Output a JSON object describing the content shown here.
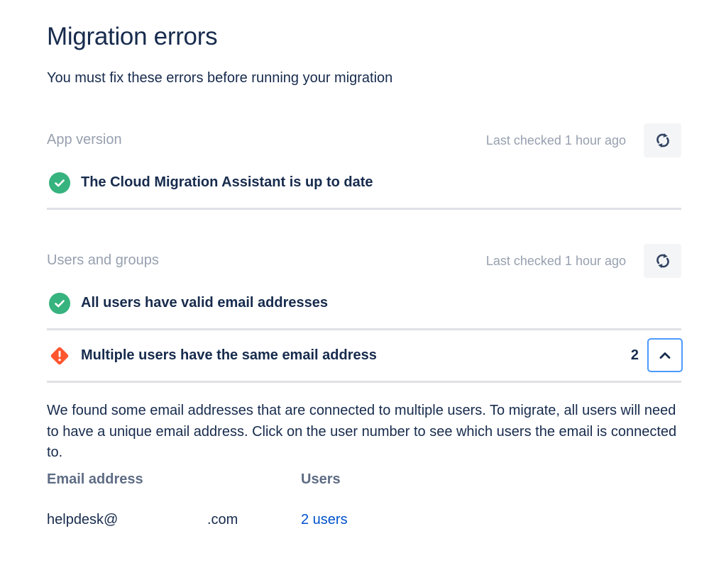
{
  "page": {
    "title": "Migration errors",
    "subtitle": "You must fix these errors before running your migration"
  },
  "sections": [
    {
      "title": "App version",
      "last_checked": "Last checked 1 hour ago",
      "checks": [
        {
          "status": "success",
          "text": "The Cloud Migration Assistant is up to date"
        }
      ]
    },
    {
      "title": "Users and groups",
      "last_checked": "Last checked 1 hour ago",
      "checks": [
        {
          "status": "success",
          "text": "All users have valid email addresses"
        },
        {
          "status": "error",
          "text": "Multiple users have the same email address",
          "count": "2",
          "expanded": true
        }
      ]
    }
  ],
  "error_details": {
    "description": "We found some email addresses that are connected to multiple users. To migrate, all users will need to have a unique email address. Click on the user number to see which users the email is connected to.",
    "table": {
      "headers": [
        "Email address",
        "Users"
      ],
      "rows": [
        {
          "email_prefix": "helpdesk@",
          "email_suffix": ".com",
          "users": "2 users"
        }
      ]
    }
  },
  "colors": {
    "success": "#36b37e",
    "error": "#ff5630",
    "link": "#0052cc",
    "focus": "#4c9aff",
    "muted": "#97a0af",
    "divider": "#dfe1e6"
  },
  "icons": {
    "refresh": "refresh-icon",
    "success": "check-circle-icon",
    "error": "error-diamond-icon",
    "expand": "chevron-up-icon"
  }
}
